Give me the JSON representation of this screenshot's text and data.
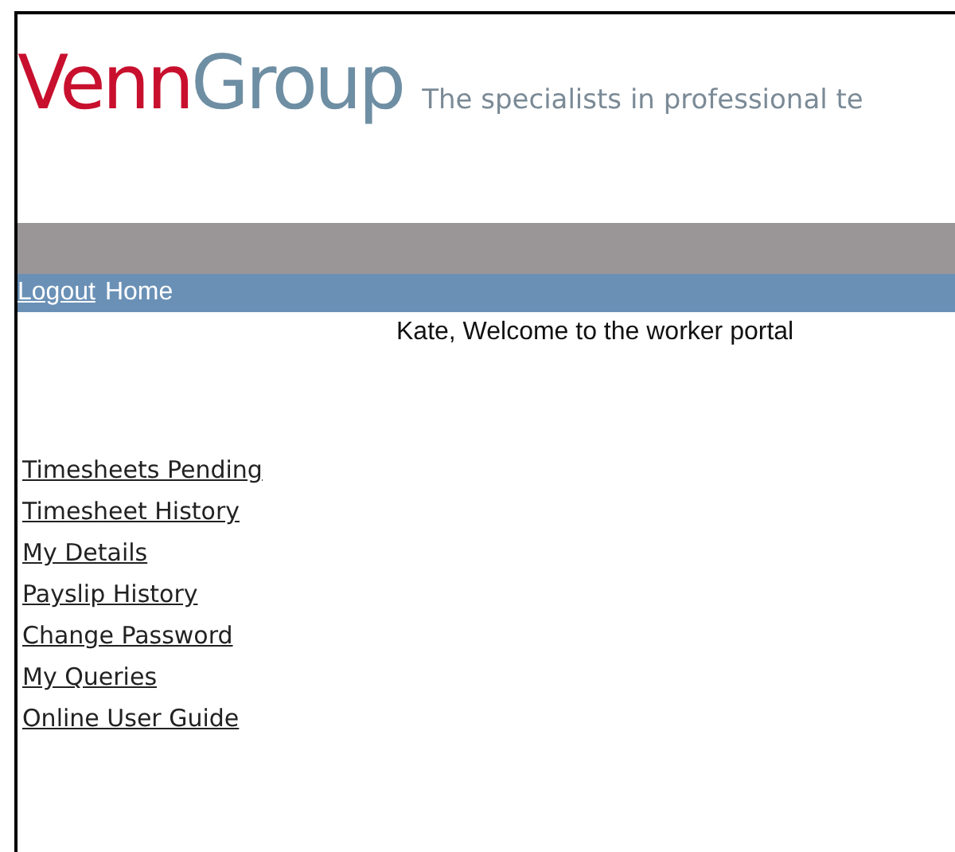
{
  "header": {
    "logo": [
      "Venn",
      "Group"
    ],
    "tagline": "The specialists in professional te"
  },
  "nav": [
    {
      "label": "Logout",
      "kind": "link"
    },
    {
      "label": "Home",
      "kind": "text"
    }
  ],
  "welcome": "Kate, Welcome to the worker portal",
  "menu": [
    "Timesheets Pending",
    "Timesheet History",
    "My Details",
    "Payslip History",
    "Change Password",
    "My Queries",
    "Online User Guide"
  ]
}
